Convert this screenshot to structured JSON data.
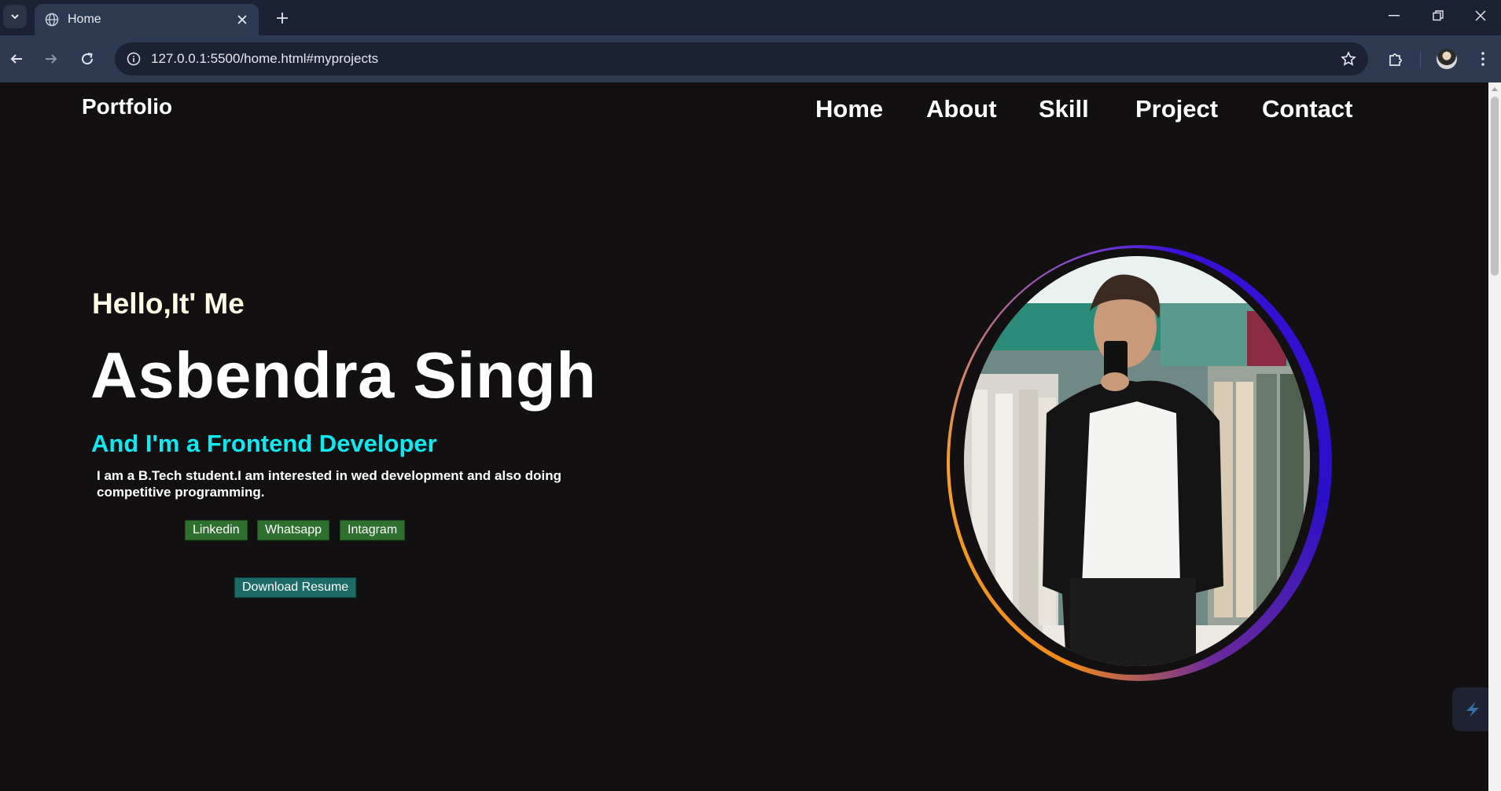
{
  "browser": {
    "tab_title": "Home",
    "url": "127.0.0.1:5500/home.html#myprojects"
  },
  "page": {
    "logo": "Portfolio",
    "nav": [
      "Home",
      "About",
      "Skill",
      "Project",
      "Contact"
    ],
    "hero": {
      "greeting": "Hello,It' Me",
      "name": "Asbendra Singh",
      "role": "And I'm a Frontend Developer",
      "bio": "I am a B.Tech student.I am interested in wed development and also doing competitive programming."
    },
    "social_buttons": [
      "Linkedin",
      "Whatsapp",
      "Intagram"
    ],
    "resume_button": "Download Resume"
  },
  "colors": {
    "background": "#121010",
    "accent_cyan": "#0ee8f0",
    "button_green": "#2f6f2f",
    "button_teal": "#1c6b68",
    "ring_orange": "#f08a1a",
    "ring_blue": "#2a0fc8"
  },
  "icons": [
    "tab-search-icon",
    "globe-icon",
    "close-icon",
    "plus-icon",
    "minimize-icon",
    "restore-icon",
    "window-close-icon",
    "back-arrow-icon",
    "forward-arrow-icon",
    "reload-icon",
    "info-icon",
    "star-icon",
    "extensions-icon",
    "profile-avatar",
    "kebab-menu-icon",
    "floating-action-icon"
  ]
}
